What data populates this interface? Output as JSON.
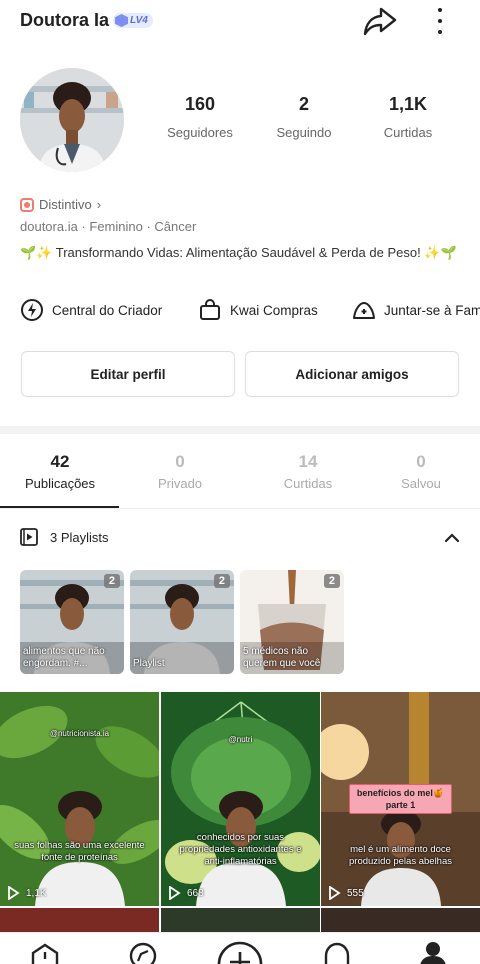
{
  "header": {
    "title": "Doutora Ia",
    "level": "LV4"
  },
  "stats": [
    {
      "value": "160",
      "label": "Seguidores"
    },
    {
      "value": "2",
      "label": "Seguindo"
    },
    {
      "value": "1,1K",
      "label": "Curtidas"
    }
  ],
  "profile": {
    "badge_label": "Distintivo",
    "meta": "doutora.ia · Feminino · Câncer",
    "bio": "🌱✨ Transformando Vidas: Alimentação Saudável & Perda de Peso! ✨🌱"
  },
  "creator_row": [
    {
      "icon": "lightning-circle-icon",
      "label": "Central do Criador"
    },
    {
      "icon": "shopping-bag-icon",
      "label": "Kwai Compras"
    },
    {
      "icon": "family-icon",
      "label": "Juntar-se à Fam"
    }
  ],
  "buttons": {
    "edit": "Editar perfil",
    "add_friends": "Adicionar amigos"
  },
  "tabs": [
    {
      "value": "42",
      "label": "Publicações"
    },
    {
      "value": "0",
      "label": "Privado"
    },
    {
      "value": "14",
      "label": "Curtidas"
    },
    {
      "value": "0",
      "label": "Salvou"
    }
  ],
  "playlists": {
    "header": "3 Playlists",
    "items": [
      {
        "count": "2",
        "caption": "alimentos que não engordam. #..."
      },
      {
        "count": "2",
        "caption": "Playlist"
      },
      {
        "count": "2",
        "caption": "5 médicos não querem que você"
      }
    ]
  },
  "posts": [
    {
      "watermark": "@nutricionista.ia",
      "caption": "suas folhas são uma excelente fonte de proteínas",
      "views": "1,1K"
    },
    {
      "watermark": "@nutri",
      "caption": "conhecidos por suas propriedades antioxidantes e anti-inflamatórias",
      "views": "668"
    },
    {
      "title": "benefícios do mel🍯 parte 1",
      "caption": "mel é um alimento doce produzido pelas abelhas",
      "views": "555"
    }
  ],
  "colors": {
    "accent": "#222222",
    "badge": "#7d8ef0",
    "distintivo": "#f07a6e"
  }
}
